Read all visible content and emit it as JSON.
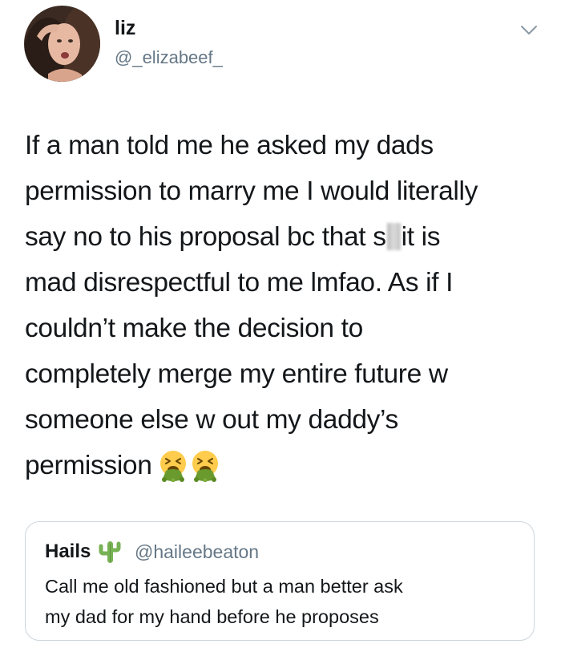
{
  "tweet": {
    "author": {
      "display_name": "liz",
      "handle": "@_elizabeef_",
      "avatar_icon": "profile-photo"
    },
    "menu_icon": "chevron-down-icon",
    "text_lines": [
      "If a man told me he asked my dads",
      "permission to marry me I would literally",
      "say no to his proposal bc that s",
      "it is",
      "mad disrespectful to me lmfao. As if I",
      "couldn’t make the decision to",
      "completely merge my entire future w",
      "someone else w out my daddy’s",
      "permission"
    ],
    "emojis": [
      "nauseated-face-icon",
      "nauseated-face-icon"
    ]
  },
  "quoted_tweet": {
    "display_name": "Hails",
    "name_emoji": "cactus-icon",
    "handle": "@haileebeaton",
    "text_lines": [
      "Call me old fashioned but a man better ask",
      "my dad for my hand before he proposes"
    ]
  },
  "colors": {
    "text_primary": "#14171a",
    "text_secondary": "#657786",
    "border": "#ccd6dd",
    "vomit_green": "#6a9a2e",
    "cactus_green": "#77b255"
  }
}
